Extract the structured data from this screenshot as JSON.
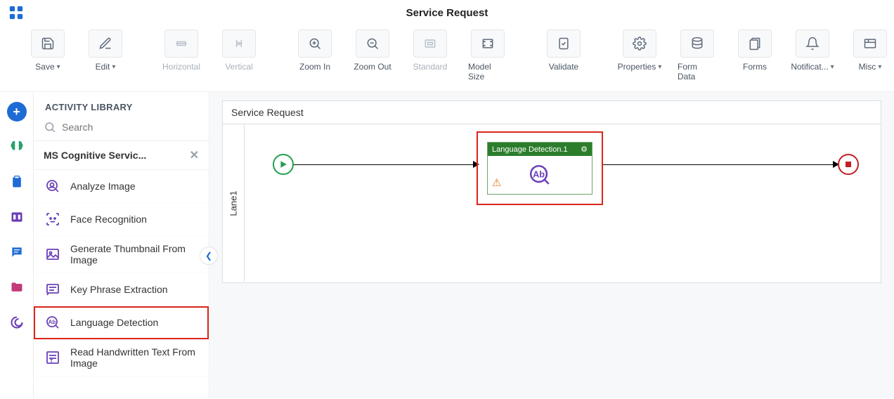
{
  "page_title": "Service Request",
  "toolbar": {
    "save": "Save",
    "edit": "Edit",
    "horizontal": "Horizontal",
    "vertical": "Vertical",
    "zoom_in": "Zoom In",
    "zoom_out": "Zoom Out",
    "standard": "Standard",
    "model_size": "Model Size",
    "validate": "Validate",
    "properties": "Properties",
    "form_data": "Form Data",
    "forms": "Forms",
    "notifications": "Notificat...",
    "misc": "Misc"
  },
  "sidebar": {
    "title": "ACTIVITY LIBRARY",
    "search_placeholder": "Search",
    "category": "MS Cognitive Servic...",
    "items": [
      {
        "label": "Analyze Image"
      },
      {
        "label": "Face Recognition"
      },
      {
        "label": "Generate Thumbnail From Image"
      },
      {
        "label": "Key Phrase Extraction"
      },
      {
        "label": "Language Detection"
      },
      {
        "label": "Read Handwritten Text From Image"
      }
    ]
  },
  "canvas": {
    "title": "Service Request",
    "lane": "Lane1",
    "activity_node_label": "Language Detection.1"
  }
}
